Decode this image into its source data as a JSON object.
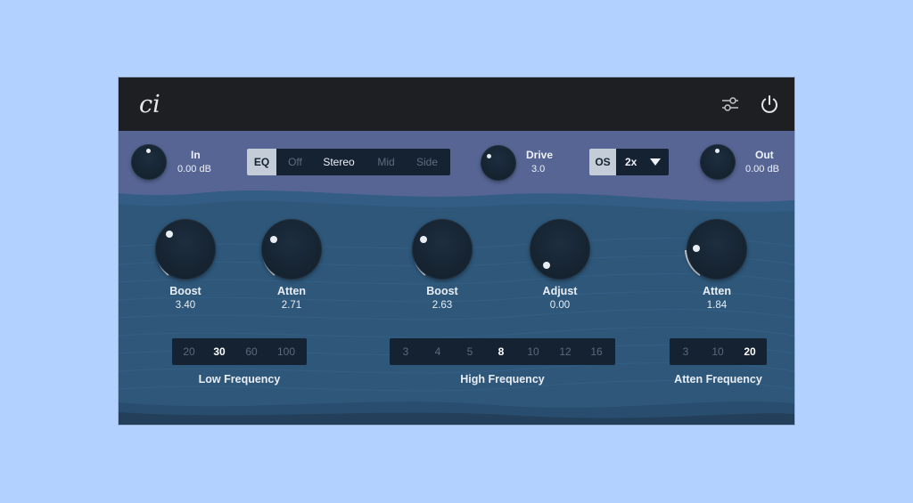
{
  "header": {
    "logo_text": "ci",
    "settings_icon": "sliders-icon",
    "power_icon": "power-icon"
  },
  "top": {
    "input": {
      "label": "In",
      "value": "0.00 dB"
    },
    "eq_mode": {
      "tag": "EQ",
      "options": [
        "Off",
        "Stereo",
        "Mid",
        "Side"
      ],
      "selected": "Stereo"
    },
    "drive": {
      "label": "Drive",
      "value": "3.0"
    },
    "oversampling": {
      "tag": "OS",
      "value": "2x"
    },
    "output": {
      "label": "Out",
      "value": "0.00 dB"
    }
  },
  "low": {
    "boost": {
      "label": "Boost",
      "value": "3.40"
    },
    "atten": {
      "label": "Atten",
      "value": "2.71"
    },
    "frequency": {
      "title": "Low Frequency",
      "options": [
        "20",
        "30",
        "60",
        "100"
      ],
      "selected": "30"
    }
  },
  "high": {
    "boost": {
      "label": "Boost",
      "value": "2.63"
    },
    "adjust": {
      "label": "Adjust",
      "value": "0.00"
    },
    "frequency": {
      "title": "High Frequency",
      "options": [
        "3",
        "4",
        "5",
        "8",
        "10",
        "12",
        "16"
      ],
      "selected": "8"
    }
  },
  "atten": {
    "atten": {
      "label": "Atten",
      "value": "1.84"
    },
    "frequency": {
      "title": "Atten Frequency",
      "options": [
        "3",
        "10",
        "20"
      ],
      "selected": "20"
    }
  },
  "colors": {
    "background": "#b3d1fe",
    "titlebar": "#1e1f22",
    "panel": "#2e577a",
    "top_strip": "#556593",
    "knob": "#15222f",
    "accent": "#e8edf3"
  }
}
